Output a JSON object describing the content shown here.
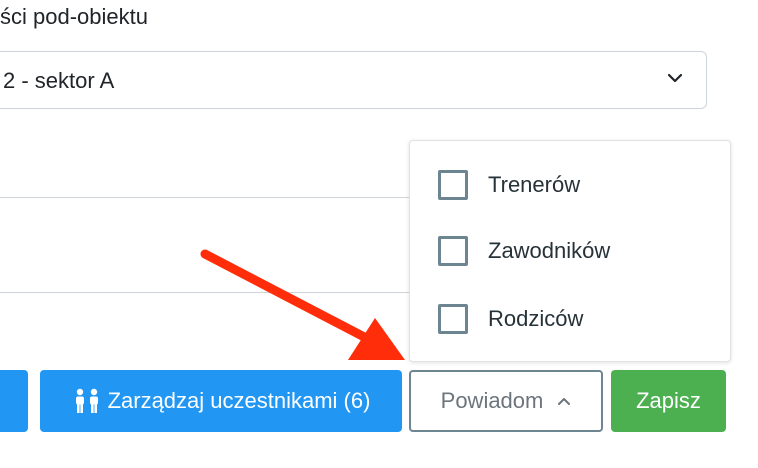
{
  "form": {
    "subobject_label": "ści pod-obiektu",
    "subobject_value": "2 - sektor A"
  },
  "dropdown": {
    "options": [
      {
        "label": "Trenerów",
        "checked": false
      },
      {
        "label": "Zawodników",
        "checked": false
      },
      {
        "label": "Rodziców",
        "checked": false
      }
    ]
  },
  "buttons": {
    "participants_label": "Zarządzaj uczestnikami (6)",
    "notify_label": "Powiadom",
    "save_label": "Zapisz"
  },
  "icons": {
    "participants": "people-icon",
    "notify_caret": "chevron-up-icon",
    "select_caret": "chevron-down-icon"
  },
  "colors": {
    "primary": "#2196f3",
    "success": "#4caf50",
    "outline": "#6c8591",
    "annotation_arrow": "#ff2d0a"
  }
}
